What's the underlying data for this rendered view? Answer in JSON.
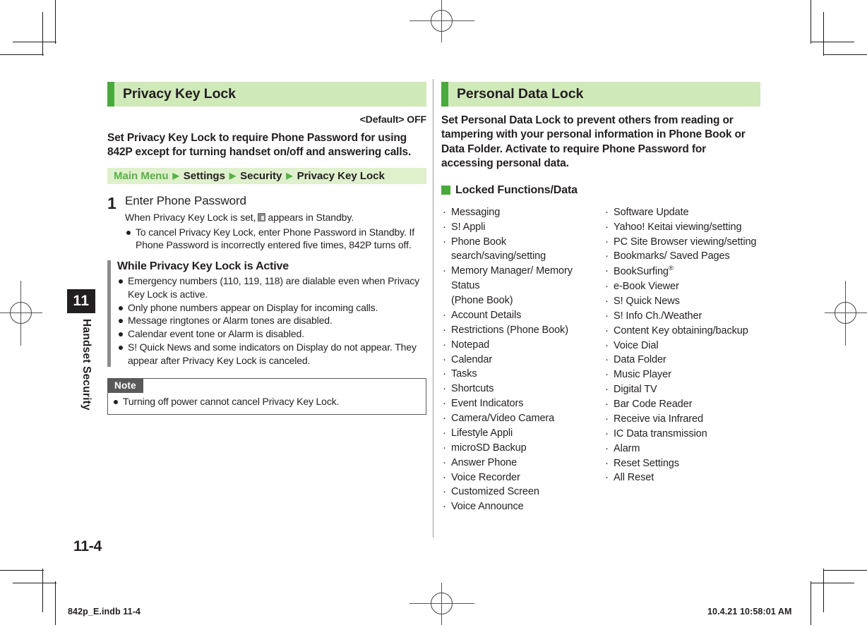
{
  "page": {
    "number": "11-4",
    "chapter_number": "11",
    "chapter_label": "Handset Security",
    "footer_left": "842p_E.indb   11-4",
    "footer_right": "10.4.21   10:58:01 AM"
  },
  "left_section": {
    "heading": "Privacy Key Lock",
    "default_line": "<Default> OFF",
    "lead": "Set Privacy Key Lock to require Phone Password for using 842P except for turning handset on/off and answering calls.",
    "nav_path": {
      "items": [
        "Main Menu",
        "Settings",
        "Security",
        "Privacy Key Lock"
      ],
      "arrow": "▶"
    },
    "step": {
      "number": "1",
      "title": "Enter Phone Password",
      "note_before_icon": "When Privacy Key Lock is set,",
      "note_icon": "phone-lock-icon",
      "note_after_icon": "appears in Standby.",
      "bullets": [
        "To cancel Privacy Key Lock, enter Phone Password in Standby. If Phone Password is incorrectly entered five times, 842P turns off."
      ]
    },
    "active_block": {
      "title": "While Privacy Key Lock is Active",
      "bullets": [
        "Emergency numbers (110, 119, 118) are dialable even when Privacy Key Lock is active.",
        "Only phone numbers appear on Display for incoming calls.",
        "Message ringtones or Alarm tones are disabled.",
        "Calendar event tone or Alarm is disabled.",
        "S! Quick News and some indicators on Display do not appear. They appear after Privacy Key Lock is canceled."
      ]
    },
    "note_box": {
      "tag": "Note",
      "bullets": [
        "Turning off power cannot cancel Privacy Key Lock."
      ]
    }
  },
  "right_section": {
    "heading": "Personal Data Lock",
    "lead": "Set Personal Data Lock to prevent others from reading or tampering with your personal information in Phone Book or Data Folder. Activate to require Phone Password for accessing personal data.",
    "subhead": "Locked Functions/Data",
    "locked_left": [
      "Messaging",
      "S! Appli",
      "Phone Book search/saving/setting",
      "Memory Manager/ Memory Status",
      "(Phone Book)",
      "Account Details",
      "Restrictions (Phone Book)",
      "Notepad",
      "Calendar",
      "Tasks",
      "Shortcuts",
      "Event Indicators",
      "Camera/Video Camera",
      "Lifestyle Appli",
      "microSD Backup",
      "Answer Phone",
      "Voice Recorder",
      "Customized Screen",
      "Voice Announce"
    ],
    "locked_left_continuation_index": 4,
    "locked_right": [
      "Software Update",
      "Yahoo! Keitai viewing/setting",
      "PC Site Browser viewing/setting",
      "Bookmarks/ Saved Pages",
      "BookSurfing®",
      "e-Book Viewer",
      "S! Quick News",
      "S! Info Ch./Weather",
      "Content Key obtaining/backup",
      "Voice Dial",
      "Data Folder",
      "Music Player",
      "Digital TV",
      "Bar Code Reader",
      "Receive via Infrared",
      "IC Data transmission",
      "Alarm",
      "Reset Settings",
      "All Reset"
    ]
  },
  "colors": {
    "accent_green": "#4aa93c",
    "header_green": "#cfe9b9",
    "nav_green": "#dff0cd",
    "text": "#231f20",
    "gray_rule": "#8c8c8c"
  }
}
